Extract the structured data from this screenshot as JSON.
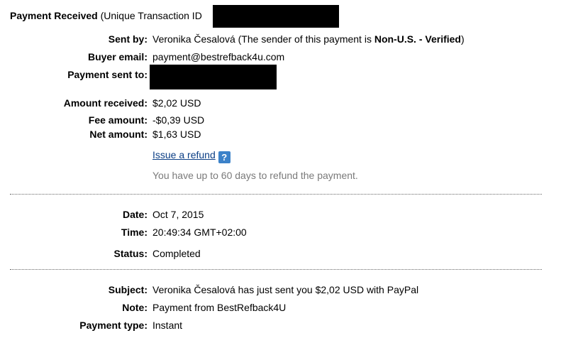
{
  "heading": {
    "title": "Payment Received",
    "subtitle": "(Unique Transaction ID"
  },
  "details": {
    "sent_by_label": "Sent by:",
    "sent_by_name": "Veronika Česalová",
    "sent_by_note_prefix": "(The sender of this payment is",
    "sent_by_status": "Non-U.S. - Verified",
    "sent_by_note_suffix": ")",
    "buyer_email_label": "Buyer email:",
    "buyer_email_value": "payment@bestrefback4u.com",
    "payment_sent_to_label": "Payment sent to:"
  },
  "amounts": {
    "amount_received_label": "Amount received:",
    "amount_received_value": "$2,02 USD",
    "fee_amount_label": "Fee amount:",
    "fee_amount_value": "-$0,39 USD",
    "net_amount_label": "Net amount:",
    "net_amount_value": "$1,63 USD",
    "refund_link": "Issue a refund",
    "help_icon": "?",
    "refund_note": "You have up to 60 days to refund the payment."
  },
  "timing": {
    "date_label": "Date:",
    "date_value": "Oct 7, 2015",
    "time_label": "Time:",
    "time_value": "20:49:34 GMT+02:00",
    "status_label": "Status:",
    "status_value": "Completed"
  },
  "info": {
    "subject_label": "Subject:",
    "subject_value": "Veronika Česalová has just sent you $2,02 USD with PayPal",
    "note_label": "Note:",
    "note_value": "Payment from BestRefback4U",
    "payment_type_label": "Payment type:",
    "payment_type_value": "Instant"
  },
  "colors": {
    "link": "#0b3e85",
    "help_icon_bg": "#3c82c9",
    "muted_text": "#7a7a7a",
    "redaction": "#000000"
  },
  "icons": {
    "help": "help-question-icon"
  }
}
